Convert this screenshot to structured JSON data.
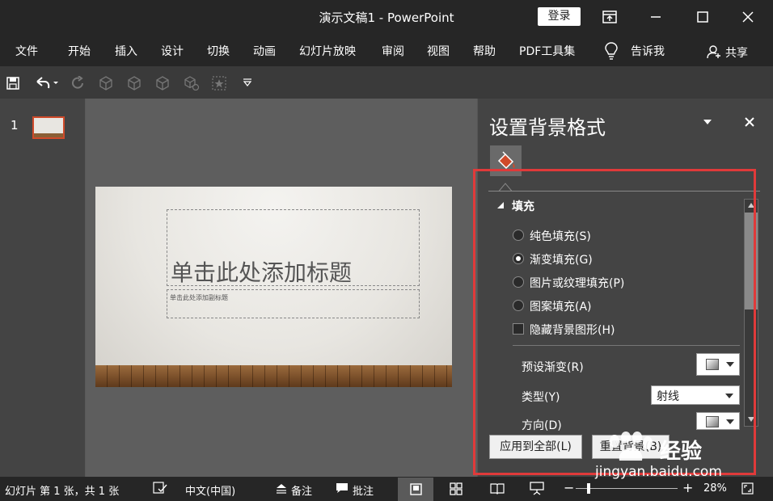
{
  "titlebar": {
    "doc_title": "演示文稿1  -  PowerPoint",
    "login_label": "登录"
  },
  "ribbon": {
    "tabs": [
      "文件",
      "开始",
      "插入",
      "设计",
      "切换",
      "动画",
      "幻灯片放映",
      "审阅",
      "视图",
      "帮助",
      "PDF工具集"
    ],
    "tell_me": "告诉我",
    "share": "共享"
  },
  "thumbnails": {
    "slide_number": "1"
  },
  "slide": {
    "title_placeholder": "单击此处添加标题",
    "subtitle_placeholder": "单击此处添加副标题"
  },
  "pane": {
    "title": "设置背景格式",
    "section": "填充",
    "options": [
      {
        "label": "纯色填充(S)",
        "type": "radio",
        "selected": false
      },
      {
        "label": "渐变填充(G)",
        "type": "radio",
        "selected": true
      },
      {
        "label": "图片或纹理填充(P)",
        "type": "radio",
        "selected": false
      },
      {
        "label": "图案填充(A)",
        "type": "radio",
        "selected": false
      },
      {
        "label": "隐藏背景图形(H)",
        "type": "checkbox",
        "selected": false
      }
    ],
    "preset_label": "预设渐变(R)",
    "type_label": "类型(Y)",
    "type_value": "射线",
    "direction_label": "方向(D)",
    "apply_all": "应用到全部(L)",
    "reset": "重置背景(B)"
  },
  "status": {
    "slide_info": "幻灯片 第 1 张，共 1 张",
    "language": "中文(中国)",
    "notes": "备注",
    "comments": "批注",
    "zoom": "28%"
  },
  "watermark": {
    "text": "经验",
    "url": "jingyan.baidu.com"
  },
  "colors": {
    "accent_red": "#e03a3a",
    "titlebar_bg": "#262626",
    "pane_bg": "#444444"
  }
}
